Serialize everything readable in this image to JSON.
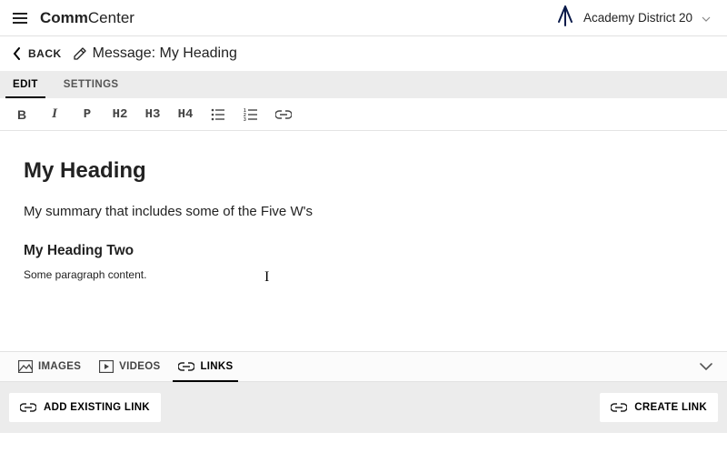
{
  "header": {
    "brand_strong": "Comm",
    "brand_light": "Center",
    "org_name": "Academy District 20"
  },
  "nav": {
    "back_label": "BACK",
    "page_title": "Message: My Heading"
  },
  "tabs": {
    "edit": "EDIT",
    "settings": "SETTINGS",
    "active": "edit"
  },
  "toolbar": {
    "bold": "B",
    "italic": "I",
    "p": "P",
    "h2": "H2",
    "h3": "H3",
    "h4": "H4"
  },
  "document": {
    "h1": "My Heading",
    "summary": "My summary that includes some of the Five W's",
    "h2": "My Heading Two",
    "paragraph": "Some paragraph content."
  },
  "media_tabs": {
    "images": "IMAGES",
    "videos": "VIDEOS",
    "links": "LINKS",
    "active": "links"
  },
  "actions": {
    "add_existing": "ADD EXISTING LINK",
    "create_link": "CREATE LINK"
  }
}
